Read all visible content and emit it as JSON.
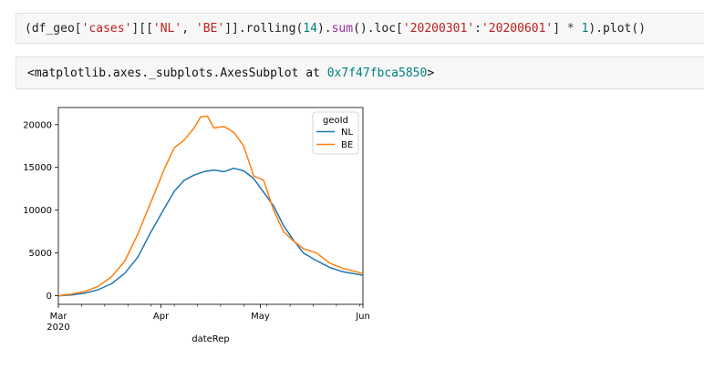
{
  "input_cell": {
    "code_tokens": [
      {
        "t": "(df_geo[",
        "c": "plain"
      },
      {
        "t": "'cases'",
        "c": "str"
      },
      {
        "t": "][[",
        "c": "plain"
      },
      {
        "t": "'NL'",
        "c": "str"
      },
      {
        "t": ", ",
        "c": "plain"
      },
      {
        "t": "'BE'",
        "c": "str"
      },
      {
        "t": "]].rolling(",
        "c": "plain"
      },
      {
        "t": "14",
        "c": "num"
      },
      {
        "t": ").",
        "c": "plain"
      },
      {
        "t": "sum",
        "c": "fn"
      },
      {
        "t": "().loc[",
        "c": "plain"
      },
      {
        "t": "'20200301'",
        "c": "str"
      },
      {
        "t": ":",
        "c": "plain"
      },
      {
        "t": "'20200601'",
        "c": "str"
      },
      {
        "t": "] ",
        "c": "plain"
      },
      {
        "t": "*",
        "c": "op"
      },
      {
        "t": " ",
        "c": "plain"
      },
      {
        "t": "1",
        "c": "num"
      },
      {
        "t": ").plot()",
        "c": "plain"
      }
    ]
  },
  "output_cell": {
    "text_prefix": "<matplotlib.axes._subplots.AxesSubplot at ",
    "address": "0x7f47fbca5850",
    "text_suffix": ">"
  },
  "chart_data": {
    "type": "line",
    "xlabel": "dateRep",
    "ylabel": "",
    "title": "",
    "x_ticks": [
      {
        "label": "Mar",
        "sublabel": "2020",
        "date": "2020-03-01"
      },
      {
        "label": "Apr",
        "sublabel": "",
        "date": "2020-04-01"
      },
      {
        "label": "May",
        "sublabel": "",
        "date": "2020-05-01"
      },
      {
        "label": "Jun",
        "sublabel": "",
        "date": "2020-06-01"
      }
    ],
    "y_ticks": [
      0,
      5000,
      10000,
      15000,
      20000
    ],
    "xlim": [
      "2020-03-01",
      "2020-06-01"
    ],
    "ylim": [
      -1000,
      22000
    ],
    "grid": false,
    "legend": {
      "title": "geoId",
      "placement": "top-right"
    },
    "series": [
      {
        "name": "NL",
        "color": "#1f77b4",
        "x": [
          "2020-03-01",
          "2020-03-05",
          "2020-03-09",
          "2020-03-13",
          "2020-03-17",
          "2020-03-21",
          "2020-03-25",
          "2020-03-29",
          "2020-04-02",
          "2020-04-05",
          "2020-04-08",
          "2020-04-11",
          "2020-04-14",
          "2020-04-17",
          "2020-04-20",
          "2020-04-23",
          "2020-04-26",
          "2020-04-29",
          "2020-05-02",
          "2020-05-05",
          "2020-05-08",
          "2020-05-11",
          "2020-05-14",
          "2020-05-18",
          "2020-05-22",
          "2020-05-26",
          "2020-06-01"
        ],
        "y": [
          0,
          100,
          300,
          700,
          1400,
          2600,
          4500,
          7500,
          10200,
          12200,
          13500,
          14100,
          14500,
          14700,
          14500,
          14900,
          14600,
          13700,
          12100,
          10500,
          8200,
          6500,
          5000,
          4100,
          3300,
          2800,
          2400
        ]
      },
      {
        "name": "BE",
        "color": "#ff7f0e",
        "x": [
          "2020-03-01",
          "2020-03-05",
          "2020-03-09",
          "2020-03-13",
          "2020-03-17",
          "2020-03-21",
          "2020-03-25",
          "2020-03-29",
          "2020-04-02",
          "2020-04-05",
          "2020-04-08",
          "2020-04-11",
          "2020-04-13",
          "2020-04-15",
          "2020-04-17",
          "2020-04-20",
          "2020-04-23",
          "2020-04-26",
          "2020-04-29",
          "2020-05-02",
          "2020-05-05",
          "2020-05-08",
          "2020-05-11",
          "2020-05-14",
          "2020-05-18",
          "2020-05-22",
          "2020-05-26",
          "2020-06-01"
        ],
        "y": [
          0,
          200,
          500,
          1100,
          2200,
          4000,
          7200,
          11000,
          14800,
          17300,
          18200,
          19600,
          20900,
          21000,
          19600,
          19800,
          19100,
          17500,
          14000,
          13500,
          10000,
          7500,
          6400,
          5500,
          5000,
          3800,
          3200,
          2600
        ]
      }
    ]
  }
}
